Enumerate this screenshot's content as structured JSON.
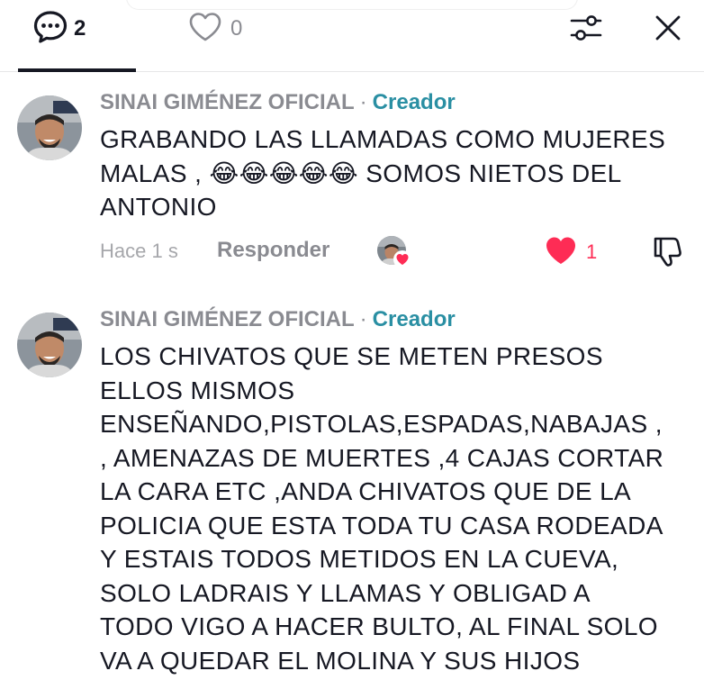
{
  "tabs": {
    "comments": {
      "icon": "comment-bubble-icon",
      "count": "2"
    },
    "likes": {
      "icon": "heart-outline-icon",
      "count": "0"
    }
  },
  "toolbar": {
    "filter_icon": "sliders-icon",
    "close_icon": "close-icon"
  },
  "colors": {
    "text": "#161823",
    "muted": "#8a8b91",
    "creator": "#2a8fa3",
    "like": "#fe2c55"
  },
  "comments": [
    {
      "author": "SINAI GIMÉNEZ OFICIAL",
      "separator": "·",
      "badge": "Creador",
      "text": "GRABANDO LAS LLAMADAS COMO MUJERES\nMALAS , 😂😂😂😂😂 SOMOS NIETOS DEL\nANTONIO",
      "time": "Hace 1 s",
      "reply_label": "Responder",
      "liked_by_creator": true,
      "likes": "1",
      "liked": true
    },
    {
      "author": "SINAI GIMÉNEZ OFICIAL",
      "separator": "·",
      "badge": "Creador",
      "text": "LOS CHIVATOS QUE SE METEN PRESOS\nELLOS MISMOS\nENSEÑANDO,PISTOLAS,ESPADAS,NABAJAS ,\n, AMENAZAS DE MUERTES ,4 CAJAS CORTAR\nLA CARA ETC ,ANDA CHIVATOS QUE DE LA\nPOLICIA QUE ESTA TODA TU CASA RODEADA\nY ESTAIS TODOS METIDOS EN LA CUEVA,\nSOLO LADRAIS Y LLAMAS Y OBLIGAD A\nTODO VIGO A HACER BULTO, AL FINAL SOLO\nVA A QUEDAR EL MOLINA Y SUS HIJOS"
    }
  ]
}
